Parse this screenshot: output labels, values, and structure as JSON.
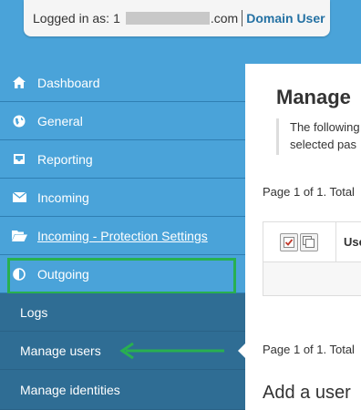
{
  "header": {
    "logged_in_label": "Logged in as:",
    "masked_prefix": "1",
    "email_suffix": ".com",
    "role": "Domain User"
  },
  "sidebar": {
    "items": [
      {
        "label": "Dashboard",
        "icon": "home-icon"
      },
      {
        "label": "General",
        "icon": "globe-icon"
      },
      {
        "label": "Reporting",
        "icon": "inbox-icon"
      },
      {
        "label": "Incoming",
        "icon": "envelope-icon"
      },
      {
        "label": "Incoming - Protection Settings",
        "icon": "folder-open-icon"
      },
      {
        "label": "Outgoing",
        "icon": "half-circle-icon"
      }
    ],
    "subitems": [
      {
        "label": "Logs"
      },
      {
        "label": "Manage users"
      },
      {
        "label": "Manage identities"
      }
    ],
    "highlight_color": "#28b050",
    "bg_color": "#4aa3d9",
    "sub_bg_color": "#2f6d94"
  },
  "main": {
    "title": "Manage",
    "info_line1": "The following",
    "info_line2": "selected pas",
    "pager_top": "Page 1 of 1. Total",
    "pager_bottom": "Page 1 of 1. Total",
    "table": {
      "column_user": "Use"
    },
    "add_user_heading": "Add a user"
  }
}
